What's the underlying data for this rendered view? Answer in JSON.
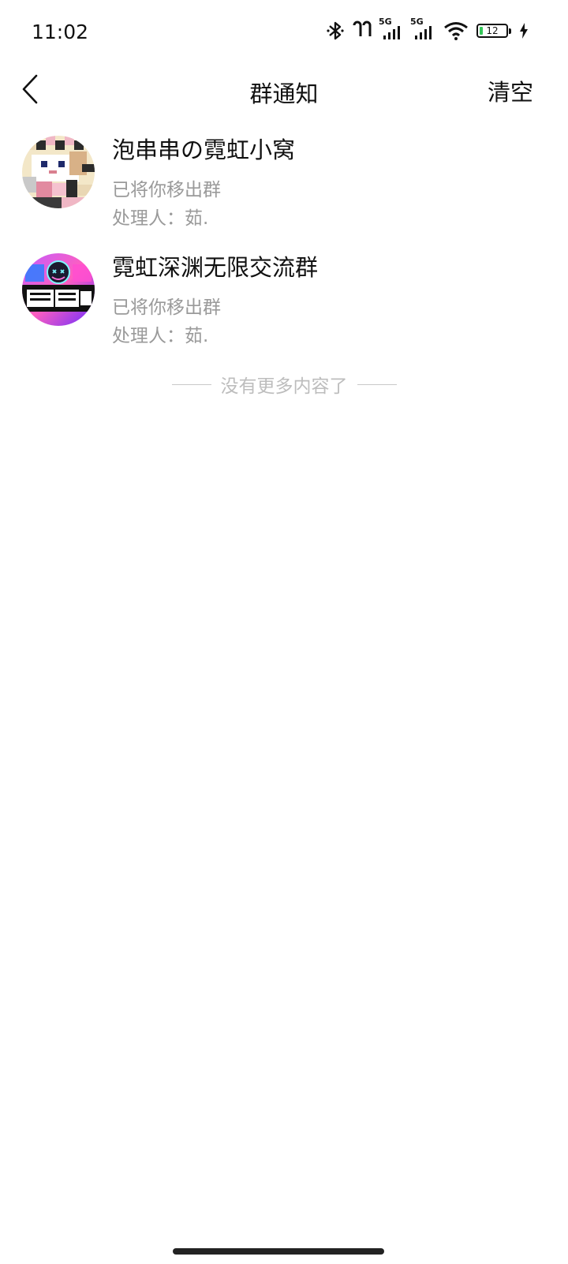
{
  "status_bar": {
    "time": "11:02",
    "network_1": "5G",
    "network_2": "5G",
    "battery_level": "12",
    "battery_fraction": 0.12,
    "icons": [
      "bluetooth-icon",
      "earbuds-icon",
      "signal-icon",
      "signal-icon",
      "wifi-icon",
      "battery-icon",
      "charging-icon"
    ]
  },
  "nav": {
    "back_icon": "chevron-left-icon",
    "title": "群通知",
    "clear_label": "清空"
  },
  "notifications": [
    {
      "group_name": "泡串串の霓虹小窝",
      "action": "已将你移出群",
      "handler": "处理人：茹."
    },
    {
      "group_name": "霓虹深渊无限交流群",
      "action": "已将你移出群",
      "handler": "处理人：茹."
    }
  ],
  "footer": {
    "end_text": "没有更多内容了"
  },
  "colors": {
    "text_primary": "#111111",
    "text_secondary": "#9a9a9a",
    "text_footer": "#bdbdbd",
    "battery": "#34c759"
  }
}
